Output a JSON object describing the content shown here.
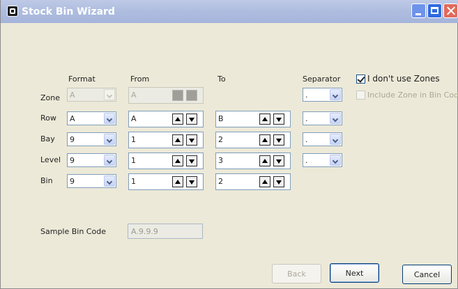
{
  "window": {
    "title": "Stock Bin Wizard"
  },
  "columns": {
    "format": "Format",
    "from": "From",
    "to": "To",
    "separator": "Separator"
  },
  "rows": {
    "zone": {
      "label": "Zone",
      "format": "A",
      "from": "A"
    },
    "row": {
      "label": "Row",
      "format": "A",
      "from": "A",
      "to": "B",
      "separator": "."
    },
    "bay": {
      "label": "Bay",
      "format": "9",
      "from": "1",
      "to": "2",
      "separator": "."
    },
    "level": {
      "label": "Level",
      "format": "9",
      "from": "1",
      "to": "3",
      "separator": "."
    },
    "bin": {
      "label": "Bin",
      "format": "9",
      "from": "1",
      "to": "2"
    }
  },
  "zone_separator": ".",
  "options": {
    "no_zones": "I don't use Zones",
    "include_zone": "Include Zone in Bin Code"
  },
  "sample": {
    "label": "Sample Bin Code",
    "value": "A.9.9.9"
  },
  "buttons": {
    "back": "Back",
    "next": "Next",
    "cancel": "Cancel"
  }
}
